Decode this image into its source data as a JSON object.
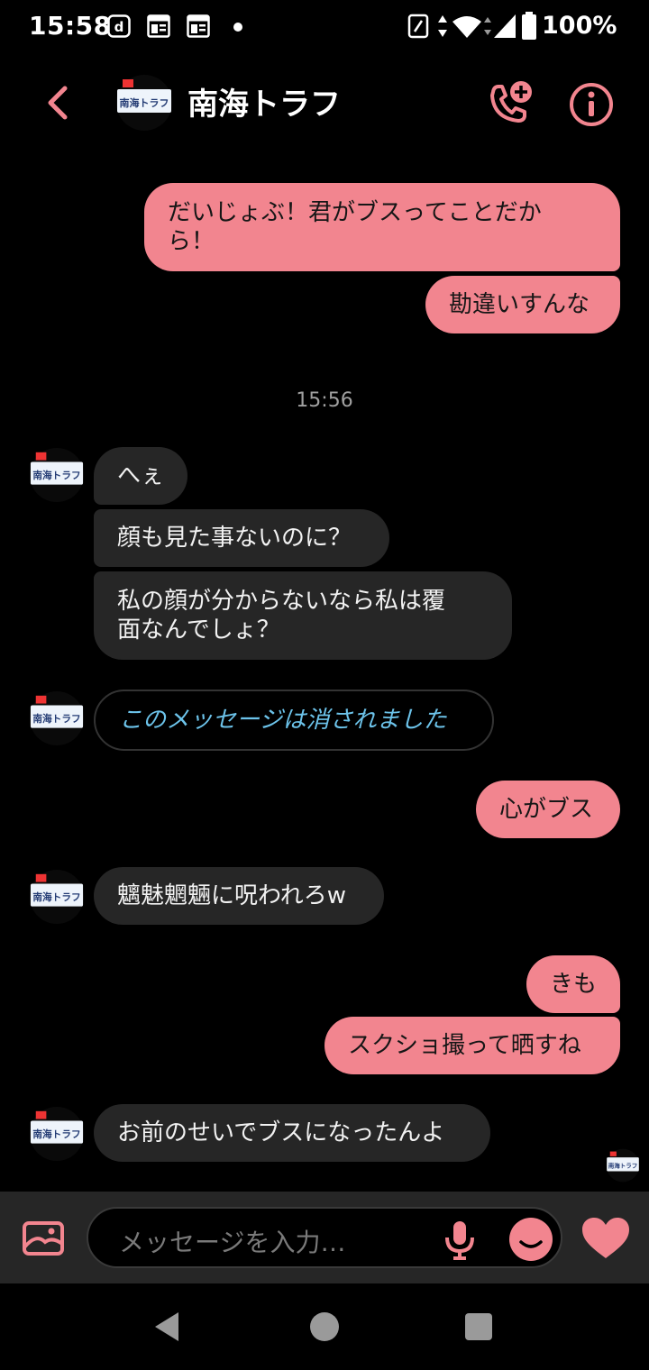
{
  "status_bar": {
    "time": "15:58",
    "notification_icons": [
      "docomo-d-icon",
      "news-icon",
      "news-icon"
    ],
    "battery": "100%"
  },
  "header": {
    "contact_name": "南海トラフ",
    "avatar_text": "南海トラフ"
  },
  "messages": {
    "m1": "だいじょぶ！君がブスってことだか\nら！",
    "m2": "勘違いすんな",
    "time_sep": "15:56",
    "m3": "へぇ",
    "m4": "顔も見た事ないのに？",
    "m5": "私の顔が分からないなら私は覆\n面なんでしょ？",
    "m6": "このメッセージは消されました",
    "m7": "心がブス",
    "m8": "魑魅魍魎に呪われろw",
    "m9": "きも",
    "m10": "スクショ撮って晒すね",
    "m11": "お前のせいでブスになったんよ"
  },
  "composer": {
    "placeholder": "メッセージを入力…"
  },
  "colors": {
    "accent": "#f2858f",
    "incoming_bubble": "#262626",
    "deleted_text": "#6cc3ea"
  }
}
